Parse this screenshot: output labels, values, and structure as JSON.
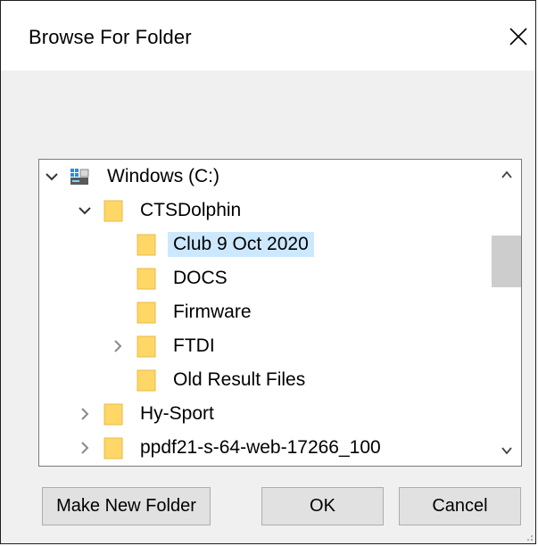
{
  "window": {
    "title": "Browse For Folder",
    "close_glyph": "✕"
  },
  "tree": {
    "items": [
      {
        "label": "Windows (C:)",
        "level": 0,
        "expander": "expanded",
        "icon": "drive-icon",
        "selected": false
      },
      {
        "label": "CTSDolphin",
        "level": 1,
        "expander": "expanded",
        "icon": "folder-icon",
        "selected": false
      },
      {
        "label": "Club 9 Oct 2020",
        "level": 2,
        "expander": "none",
        "icon": "folder-icon",
        "selected": true
      },
      {
        "label": "DOCS",
        "level": 2,
        "expander": "none",
        "icon": "folder-icon",
        "selected": false
      },
      {
        "label": "Firmware",
        "level": 2,
        "expander": "none",
        "icon": "folder-icon",
        "selected": false
      },
      {
        "label": "FTDI",
        "level": 2,
        "expander": "collapsed",
        "icon": "folder-icon",
        "selected": false
      },
      {
        "label": "Old Result Files",
        "level": 2,
        "expander": "none",
        "icon": "folder-icon",
        "selected": false
      },
      {
        "label": "Hy-Sport",
        "level": 1,
        "expander": "collapsed",
        "icon": "folder-icon",
        "selected": false
      },
      {
        "label": "ppdf21-s-64-web-17266_100",
        "level": 1,
        "expander": "collapsed",
        "icon": "folder-icon",
        "selected": false
      }
    ]
  },
  "buttons": {
    "make_new_folder": "Make New Folder",
    "ok": "OK",
    "cancel": "Cancel"
  },
  "colors": {
    "selection": "#cce8ff",
    "folder": "#ffd766",
    "folder_edge": "#e8b84a"
  }
}
